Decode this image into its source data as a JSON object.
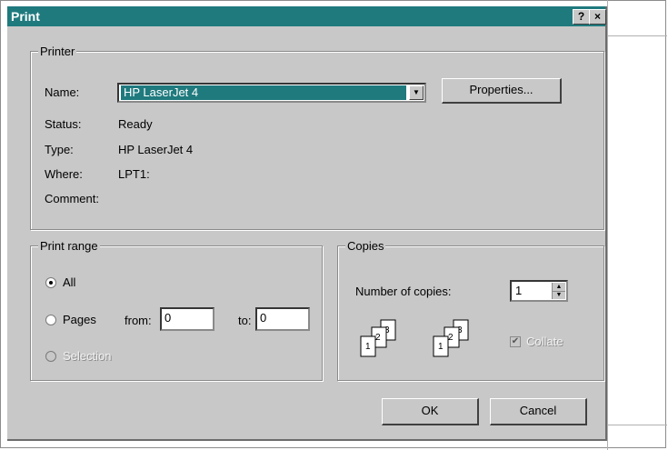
{
  "dialog": {
    "title": "Print",
    "help_label": "?",
    "close_label": "×"
  },
  "printer": {
    "group_label": "Printer",
    "name_label": "Name:",
    "name_value": "HP LaserJet 4",
    "properties_label": "Properties...",
    "status_label": "Status:",
    "status_value": "Ready",
    "type_label": "Type:",
    "type_value": "HP LaserJet 4",
    "where_label": "Where:",
    "where_value": "LPT1:",
    "comment_label": "Comment:",
    "comment_value": ""
  },
  "print_range": {
    "group_label": "Print range",
    "all_label": "All",
    "pages_label": "Pages",
    "from_label": "from:",
    "from_value": "0",
    "to_label": "to:",
    "to_value": "0",
    "selection_label": "Selection",
    "selected": "All"
  },
  "copies": {
    "group_label": "Copies",
    "number_label": "Number of copies:",
    "number_value": "1",
    "collate_label": "Collate",
    "collate_checked": true,
    "collate_enabled": false,
    "icon_digits": [
      "1",
      "2",
      "3"
    ]
  },
  "buttons": {
    "ok_label": "OK",
    "cancel_label": "Cancel"
  },
  "colors": {
    "titlebar": "#1f7a7e",
    "dialog_face": "#c8c8c8",
    "selection": "#1f7a7e"
  }
}
